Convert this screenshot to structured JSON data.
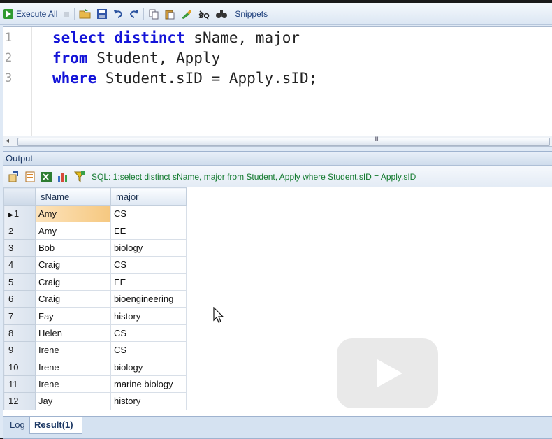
{
  "toolbar": {
    "execute_label": "Execute All",
    "snippets_label": "Snippets"
  },
  "editor": {
    "line_numbers": [
      "1",
      "2",
      "3"
    ],
    "lines": [
      {
        "kw": "select distinct",
        "rest": " sName, major"
      },
      {
        "kw": "from",
        "rest": " Student, Apply"
      },
      {
        "kw": "where",
        "rest": " Student.sID = Apply.sID;"
      }
    ],
    "scroll_grip": "III"
  },
  "output": {
    "title": "Output",
    "sql_message": "SQL: 1:select distinct sName, major  from Student, Apply  where Student.sID = Apply.sID"
  },
  "grid": {
    "columns": [
      "sName",
      "major"
    ],
    "current_marker": "▶",
    "rows": [
      {
        "n": "1",
        "sName": "Amy",
        "major": "CS"
      },
      {
        "n": "2",
        "sName": "Amy",
        "major": "EE"
      },
      {
        "n": "3",
        "sName": "Bob",
        "major": "biology"
      },
      {
        "n": "4",
        "sName": "Craig",
        "major": "CS"
      },
      {
        "n": "5",
        "sName": "Craig",
        "major": "EE"
      },
      {
        "n": "6",
        "sName": "Craig",
        "major": "bioengineering"
      },
      {
        "n": "7",
        "sName": "Fay",
        "major": "history"
      },
      {
        "n": "8",
        "sName": "Helen",
        "major": "CS"
      },
      {
        "n": "9",
        "sName": "Irene",
        "major": "CS"
      },
      {
        "n": "10",
        "sName": "Irene",
        "major": "biology"
      },
      {
        "n": "11",
        "sName": "Irene",
        "major": "marine biology"
      },
      {
        "n": "12",
        "sName": "Jay",
        "major": "history"
      }
    ]
  },
  "tabs": {
    "log": "Log",
    "result": "Result(1)"
  },
  "colors": {
    "keyword": "#1414d8",
    "sql_message": "#137a2e",
    "current_row": "#f6c880"
  }
}
